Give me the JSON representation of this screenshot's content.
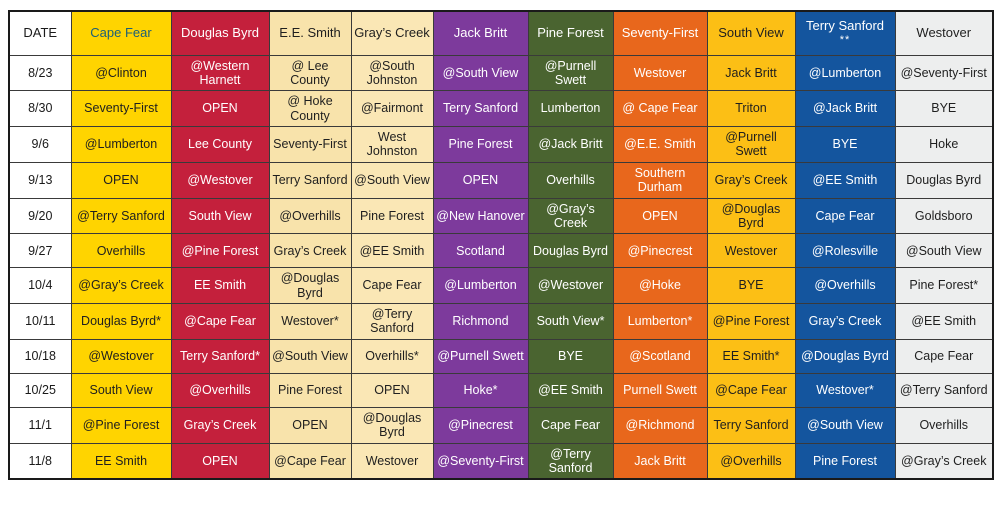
{
  "table": {
    "columns": [
      {
        "key": "date",
        "label": "DATE",
        "theme": "col-date",
        "note": ""
      },
      {
        "key": "capefear",
        "label": "Cape Fear",
        "theme": "col-capefear",
        "note": ""
      },
      {
        "key": "douglas",
        "label": "Douglas Byrd",
        "theme": "col-douglas",
        "note": ""
      },
      {
        "key": "eesmith",
        "label": "E.E. Smith",
        "theme": "col-eesmith",
        "note": ""
      },
      {
        "key": "grays",
        "label": "Gray’s Creek",
        "theme": "col-grays",
        "note": ""
      },
      {
        "key": "jackbritt",
        "label": "Jack Britt",
        "theme": "col-jackbritt",
        "note": ""
      },
      {
        "key": "pine",
        "label": "Pine Forest",
        "theme": "col-pine",
        "note": ""
      },
      {
        "key": "seventy",
        "label": "Seventy-First",
        "theme": "col-seventy",
        "note": ""
      },
      {
        "key": "southview",
        "label": "South View",
        "theme": "col-southview",
        "note": ""
      },
      {
        "key": "terry",
        "label": "Terry Sanford",
        "theme": "col-terry",
        "note": "**"
      },
      {
        "key": "westover",
        "label": "Westover",
        "theme": "col-westover",
        "note": ""
      }
    ],
    "rows": [
      {
        "date": "8/23",
        "cells": [
          "@Clinton",
          "@Western Harnett",
          "@ Lee County",
          "@South Johnston",
          "@South View",
          "@Purnell Swett",
          "Westover",
          "Jack Britt",
          "@Lumberton",
          "@Seventy-First"
        ]
      },
      {
        "date": "8/30",
        "cells": [
          "Seventy-First",
          "OPEN",
          "@ Hoke County",
          "@Fairmont",
          "Terry Sanford",
          "Lumberton",
          "@ Cape Fear",
          "Triton",
          "@Jack Britt",
          "BYE"
        ]
      },
      {
        "date": "9/6",
        "cells": [
          "@Lumberton",
          "Lee County",
          "Seventy-First",
          "West Johnston",
          "Pine Forest",
          "@Jack Britt",
          "@E.E. Smith",
          "@Purnell Swett",
          "BYE",
          "Hoke"
        ]
      },
      {
        "date": "9/13",
        "cells": [
          "OPEN",
          "@Westover",
          "Terry Sanford",
          "@South View",
          "OPEN",
          "Overhills",
          "Southern Durham",
          "Gray’s Creek",
          "@EE Smith",
          "Douglas Byrd"
        ]
      },
      {
        "date": "9/20",
        "cells": [
          "@Terry Sanford",
          "South View",
          "@Overhills",
          "Pine Forest",
          "@New Hanover",
          "@Gray’s Creek",
          "OPEN",
          "@Douglas Byrd",
          "Cape Fear",
          "Goldsboro"
        ]
      },
      {
        "date": "9/27",
        "cells": [
          "Overhills",
          "@Pine Forest",
          "Gray’s Creek",
          "@EE Smith",
          "Scotland",
          "Douglas Byrd",
          "@Pinecrest",
          "Westover",
          "@Rolesville",
          "@South View"
        ]
      },
      {
        "date": "10/4",
        "cells": [
          "@Gray’s Creek",
          "EE Smith",
          "@Douglas Byrd",
          "Cape Fear",
          "@Lumberton",
          "@Westover",
          "@Hoke",
          "BYE",
          "@Overhills",
          "Pine Forest*"
        ]
      },
      {
        "date": "10/11",
        "cells": [
          "Douglas Byrd*",
          "@Cape Fear",
          "Westover*",
          "@Terry Sanford",
          "Richmond",
          "South View*",
          "Lumberton*",
          "@Pine Forest",
          "Gray’s Creek",
          "@EE Smith"
        ]
      },
      {
        "date": "10/18",
        "cells": [
          "@Westover",
          "Terry Sanford*",
          "@South View",
          "Overhills*",
          "@Purnell Swett",
          "BYE",
          "@Scotland",
          "EE Smith*",
          "@Douglas Byrd",
          "Cape Fear"
        ]
      },
      {
        "date": "10/25",
        "cells": [
          "South View",
          "@Overhills",
          "Pine Forest",
          "OPEN",
          "Hoke*",
          "@EE Smith",
          "Purnell Swett",
          "@Cape Fear",
          "Westover*",
          "@Terry Sanford"
        ]
      },
      {
        "date": "11/1",
        "cells": [
          "@Pine Forest",
          "Gray’s Creek",
          "OPEN",
          "@Douglas Byrd",
          "@Pinecrest",
          "Cape Fear",
          "@Richmond",
          "Terry Sanford",
          "@South View",
          "Overhills"
        ]
      },
      {
        "date": "11/8",
        "cells": [
          "EE Smith",
          "OPEN",
          "@Cape Fear",
          "Westover",
          "@Seventy-First",
          "@Terry Sanford",
          "Jack Britt",
          "@Overhills",
          "Pine Forest",
          "@Gray’s Creek"
        ]
      }
    ]
  },
  "colors": {
    "cape_fear": "#ffd400",
    "douglas_byrd": "#c4203c",
    "ee_smith": "#f8e3ab",
    "grays_creek": "#fae7b5",
    "jack_britt": "#7d3a9c",
    "pine_forest": "#4a6430",
    "seventy_first": "#e8671c",
    "south_view": "#fcbf15",
    "terry_sanford": "#14559e",
    "westover": "#edeeee",
    "cape_fear_header_text": "#1b5f79"
  }
}
